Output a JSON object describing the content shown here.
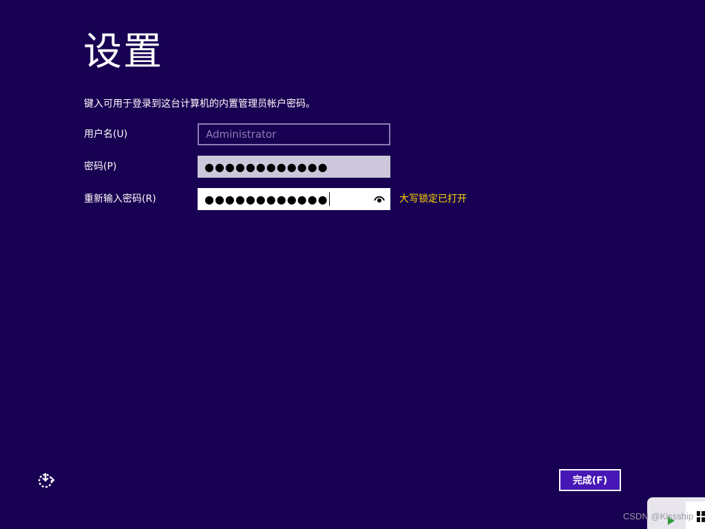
{
  "page": {
    "title": "设置",
    "instruction": "键入可用于登录到这台计算机的内置管理员帐户密码。"
  },
  "form": {
    "username": {
      "label": "用户名(U)",
      "value": "Administrator"
    },
    "password": {
      "label": "密码(P)",
      "value": "●●●●●●●●●●●●"
    },
    "confirm_password": {
      "label": "重新输入密码(R)",
      "value": "●●●●●●●●●●●●"
    },
    "capslock_warning": "大写锁定已打开"
  },
  "footer": {
    "ease_of_access_icon": "ease-of-access-icon",
    "finish_label": "完成(F)"
  },
  "watermark": "CSDN @Kissship",
  "colors": {
    "background": "#180052",
    "warning": "#ffd700",
    "button": "#4617b4"
  }
}
